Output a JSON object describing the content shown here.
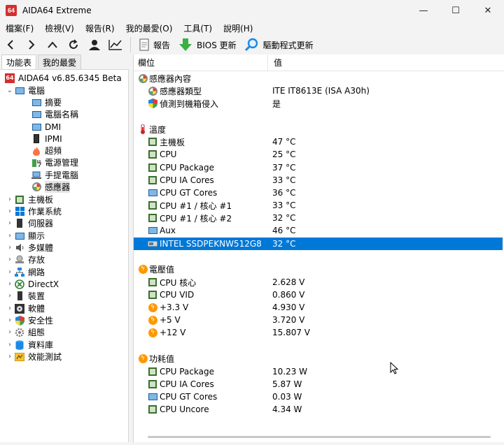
{
  "window": {
    "title": "AIDA64 Extreme",
    "logo": "64",
    "minimize": "—",
    "maximize": "☐",
    "close": "✕"
  },
  "menu": [
    "檔案(F)",
    "檢視(V)",
    "報告(R)",
    "我的最愛(O)",
    "工具(T)",
    "說明(H)"
  ],
  "toolbar": {
    "report_label": "報告",
    "bios_label": "BIOS 更新",
    "driver_label": "驅動程式更新"
  },
  "tabs": [
    "功能表",
    "我的最愛"
  ],
  "tree": {
    "root": "AIDA64 v6.85.6345 Beta",
    "computer": "電腦",
    "computer_children": [
      "摘要",
      "電腦名稱",
      "DMI",
      "IPMI",
      "超頻",
      "電源管理",
      "手提電腦",
      "感應器"
    ],
    "top_items": [
      "主機板",
      "作業系統",
      "伺服器",
      "顯示",
      "多媒體",
      "存放",
      "網路",
      "DirectX",
      "裝置",
      "軟體",
      "安全性",
      "組態",
      "資料庫",
      "效能測試"
    ]
  },
  "columns": {
    "field": "欄位",
    "value": "值"
  },
  "sections": {
    "sensor": {
      "title": "感應器內容",
      "rows": [
        {
          "field": "感應器類型",
          "value": "ITE IT8613E  (ISA A30h)"
        },
        {
          "field": "偵測到機箱侵入",
          "value": "是"
        }
      ]
    },
    "temp": {
      "title": "溫度",
      "rows": [
        {
          "field": "主機板",
          "value": "47 °C"
        },
        {
          "field": "CPU",
          "value": "25 °C"
        },
        {
          "field": "CPU Package",
          "value": "37 °C"
        },
        {
          "field": "CPU IA Cores",
          "value": "33 °C"
        },
        {
          "field": "CPU GT Cores",
          "value": "36 °C"
        },
        {
          "field": "CPU #1 / 核心 #1",
          "value": "33 °C"
        },
        {
          "field": "CPU #1 / 核心 #2",
          "value": "32 °C"
        },
        {
          "field": "Aux",
          "value": "46 °C"
        },
        {
          "field": "INTEL SSDPEKNW512G8",
          "value": "32 °C"
        }
      ]
    },
    "voltage": {
      "title": "電壓值",
      "rows": [
        {
          "field": "CPU 核心",
          "value": "2.628 V"
        },
        {
          "field": "CPU VID",
          "value": "0.860 V"
        },
        {
          "field": "+3.3 V",
          "value": "4.930 V"
        },
        {
          "field": "+5 V",
          "value": "3.720 V"
        },
        {
          "field": "+12 V",
          "value": "15.807 V"
        }
      ]
    },
    "power": {
      "title": "功耗值",
      "rows": [
        {
          "field": "CPU Package",
          "value": "10.23 W"
        },
        {
          "field": "CPU IA Cores",
          "value": "5.87 W"
        },
        {
          "field": "CPU GT Cores",
          "value": "0.03 W"
        },
        {
          "field": "CPU Uncore",
          "value": "4.34 W"
        }
      ]
    }
  }
}
